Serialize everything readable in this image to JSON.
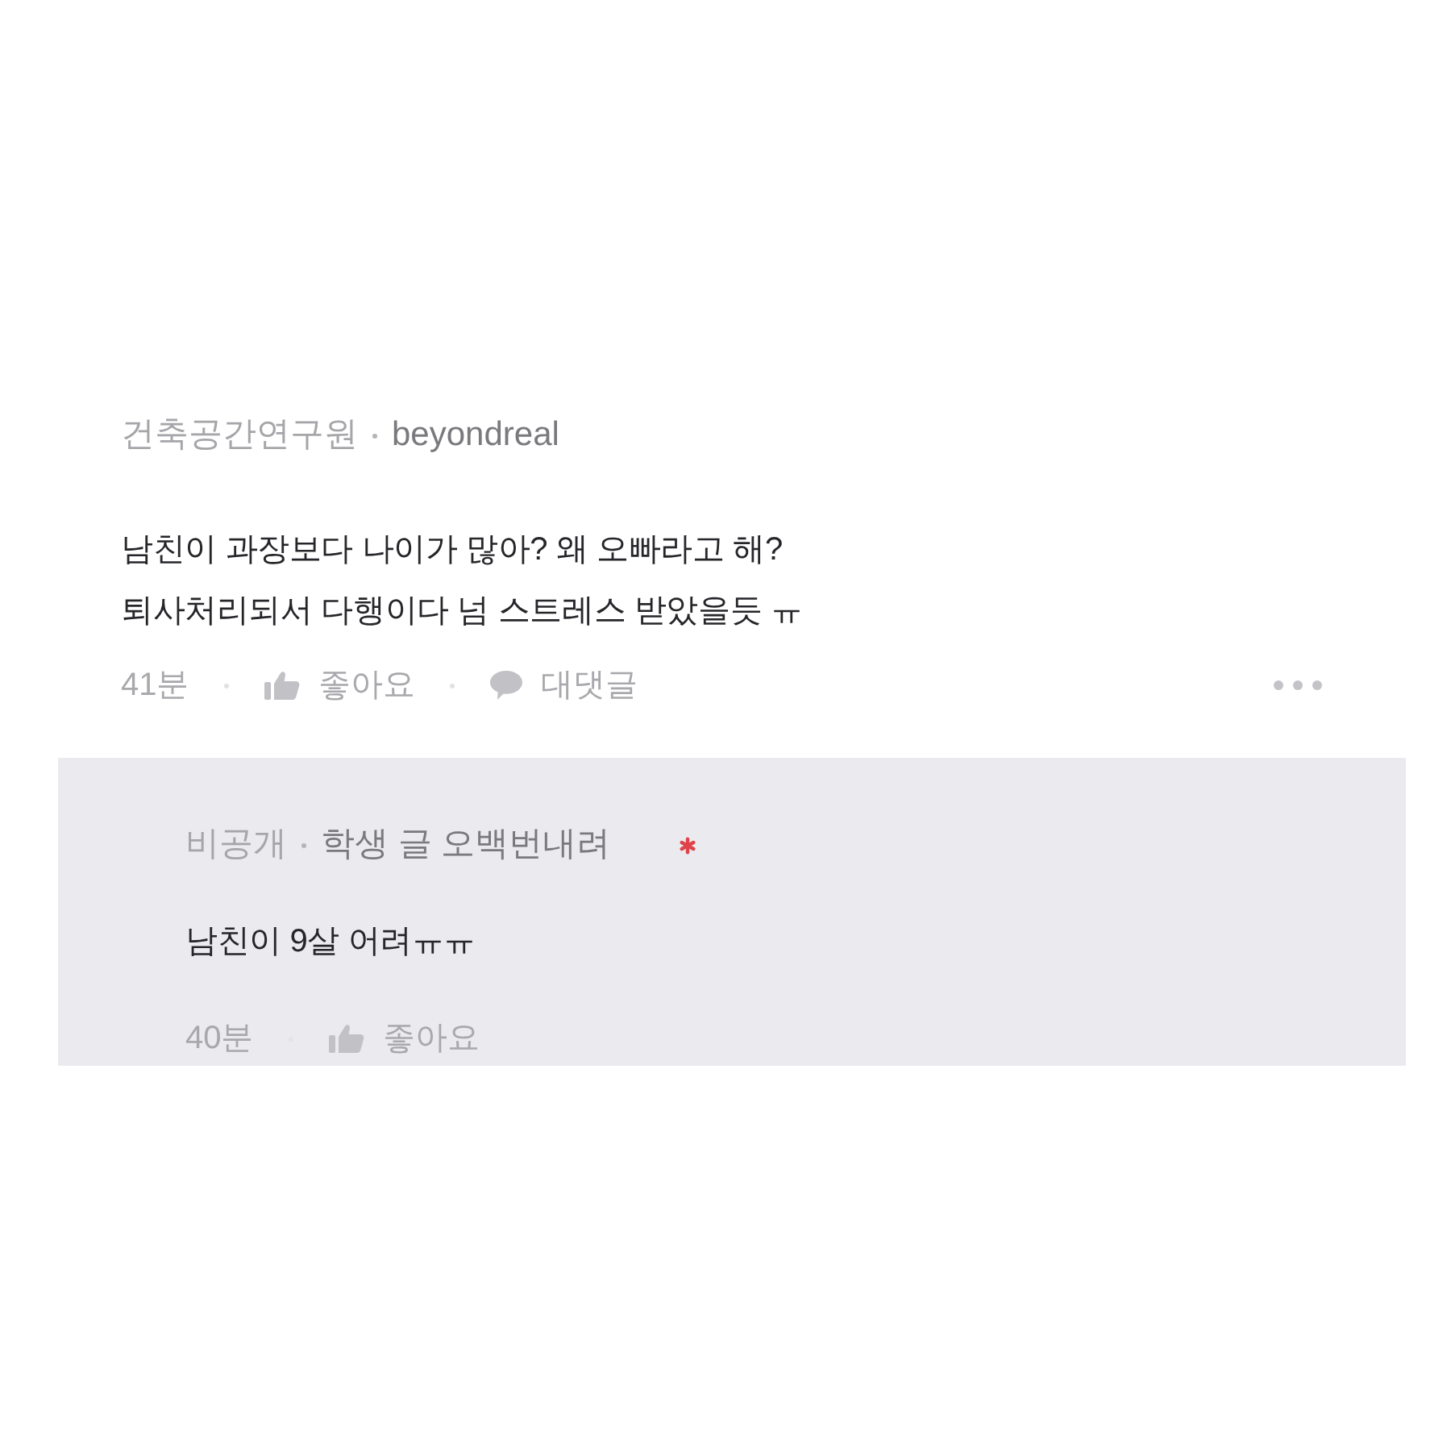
{
  "comments": [
    {
      "kind": "comment",
      "department": "건축공간연구원",
      "nickname": "beyondreal",
      "author_mark": false,
      "body": "남친이 과장보다 나이가 많아? 왜 오빠라고 해?\n퇴사처리되서 다행이다 넘 스트레스 받았을듯 ㅠ",
      "time": "41분",
      "like_label": "좋아요",
      "reply_label": "대댓글",
      "more_menu": true
    },
    {
      "kind": "reply",
      "department": "비공개",
      "nickname": "학생 글 오백번내려",
      "author_mark": true,
      "body": "남친이 9살 어려ㅠㅠ",
      "time": "40분",
      "like_label": "좋아요",
      "more_menu": false
    }
  ]
}
